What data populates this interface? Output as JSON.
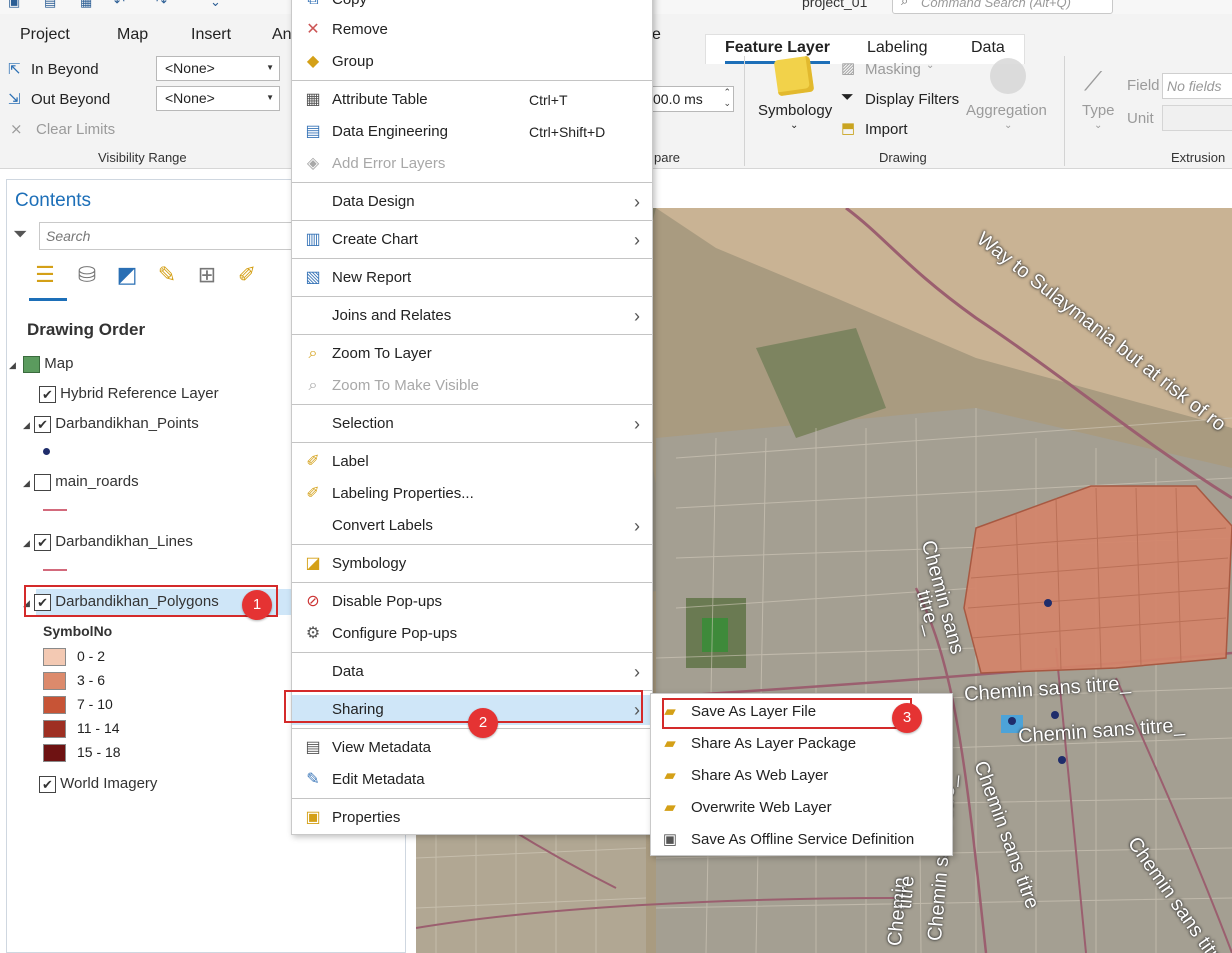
{
  "titlebar": {
    "project_name": "project_01",
    "command_search_placeholder": "Command Search (Alt+Q)"
  },
  "ribbon": {
    "tabs": [
      "Project",
      "Map",
      "Insert",
      "An",
      "e"
    ],
    "context_tabs": [
      "Feature Layer",
      "Labeling",
      "Data"
    ],
    "visibility": {
      "in_beyond": "In Beyond",
      "out_beyond": "Out Beyond",
      "clear_limits": "Clear Limits",
      "in_value": "<None>",
      "out_value": "<None>",
      "group_label": "Visibility Range"
    },
    "compare": {
      "value": "00.0",
      "unit": "ms",
      "group_label": "pare"
    },
    "drawing": {
      "symbology": "Symbology",
      "masking": "Masking",
      "display_filters": "Display Filters",
      "import": "Import",
      "aggregation": "Aggregation",
      "group_label": "Drawing"
    },
    "extrusion": {
      "type": "Type",
      "field_label": "Field",
      "field_value": "No fields",
      "unit_label": "Unit",
      "group_label": "Extrusion"
    }
  },
  "contents": {
    "title": "Contents",
    "search_placeholder": "Search",
    "drawing_order": "Drawing Order",
    "map_label": "Map",
    "layers": [
      "Hybrid Reference Layer",
      "Darbandikhan_Points",
      "main_roards",
      "Darbandikhan_Lines",
      "Darbandikhan_Polygons",
      "World Imagery"
    ],
    "symbol_field": "SymbolNo",
    "legend": [
      {
        "label": "0 - 2",
        "color": "#f3c9b3"
      },
      {
        "label": "3 - 6",
        "color": "#dc8a6c"
      },
      {
        "label": "7 - 10",
        "color": "#c75436"
      },
      {
        "label": "11 - 14",
        "color": "#9e2f22"
      },
      {
        "label": "15 - 18",
        "color": "#6e1212"
      }
    ]
  },
  "context_menu": {
    "items": [
      {
        "label": "Copy",
        "shortcut": "",
        "icon": "copy-icon"
      },
      {
        "label": "Remove",
        "shortcut": "",
        "icon": "remove-icon"
      },
      {
        "label": "Group",
        "shortcut": "",
        "icon": "group-icon"
      },
      {
        "label": "Attribute Table",
        "shortcut": "Ctrl+T",
        "icon": "table-icon"
      },
      {
        "label": "Data Engineering",
        "shortcut": "Ctrl+Shift+D",
        "icon": "data-engineering-icon"
      },
      {
        "label": "Add Error Layers",
        "shortcut": "",
        "icon": "error-layers-icon"
      },
      {
        "label": "Data Design",
        "shortcut": "",
        "icon": ""
      },
      {
        "label": "Create Chart",
        "shortcut": "",
        "icon": "chart-icon"
      },
      {
        "label": "New Report",
        "shortcut": "",
        "icon": "report-icon"
      },
      {
        "label": "Joins and Relates",
        "shortcut": "",
        "icon": ""
      },
      {
        "label": "Zoom To Layer",
        "shortcut": "",
        "icon": "zoom-layer-icon"
      },
      {
        "label": "Zoom To Make Visible",
        "shortcut": "",
        "icon": "zoom-visible-icon"
      },
      {
        "label": "Selection",
        "shortcut": "",
        "icon": ""
      },
      {
        "label": "Label",
        "shortcut": "",
        "icon": "label-icon"
      },
      {
        "label": "Labeling Properties...",
        "shortcut": "",
        "icon": "labeling-properties-icon"
      },
      {
        "label": "Convert Labels",
        "shortcut": "",
        "icon": ""
      },
      {
        "label": "Symbology",
        "shortcut": "",
        "icon": "symbology-icon"
      },
      {
        "label": "Disable Pop-ups",
        "shortcut": "",
        "icon": "disable-popups-icon"
      },
      {
        "label": "Configure Pop-ups",
        "shortcut": "",
        "icon": "configure-popups-icon"
      },
      {
        "label": "Data",
        "shortcut": "",
        "icon": ""
      },
      {
        "label": "Sharing",
        "shortcut": "",
        "icon": ""
      },
      {
        "label": "View Metadata",
        "shortcut": "",
        "icon": "view-metadata-icon"
      },
      {
        "label": "Edit Metadata",
        "shortcut": "",
        "icon": "edit-metadata-icon"
      },
      {
        "label": "Properties",
        "shortcut": "",
        "icon": "properties-icon"
      }
    ]
  },
  "sharing_submenu": {
    "items": [
      "Save As Layer File",
      "Share As Layer Package",
      "Share As Web Layer",
      "Overwrite Web Layer",
      "Save As Offline Service Definition"
    ]
  },
  "callouts": [
    "1",
    "2",
    "3"
  ],
  "map_labels": [
    "Way to Sulaymania but at risk of ro",
    "Chemin sans titre_",
    "Chemin sans titre_",
    "Chemin sans titre_",
    "Chemin sans titre_",
    "Chemin sans titre",
    "Chemin sans",
    "titre_",
    "Chemin",
    "titre",
    "Chemin sans titre_",
    "Chemin sans titre_"
  ],
  "colors": {
    "accent": "#1d6fb8",
    "highlight": "#cfe6f8",
    "callout": "#e53333"
  }
}
